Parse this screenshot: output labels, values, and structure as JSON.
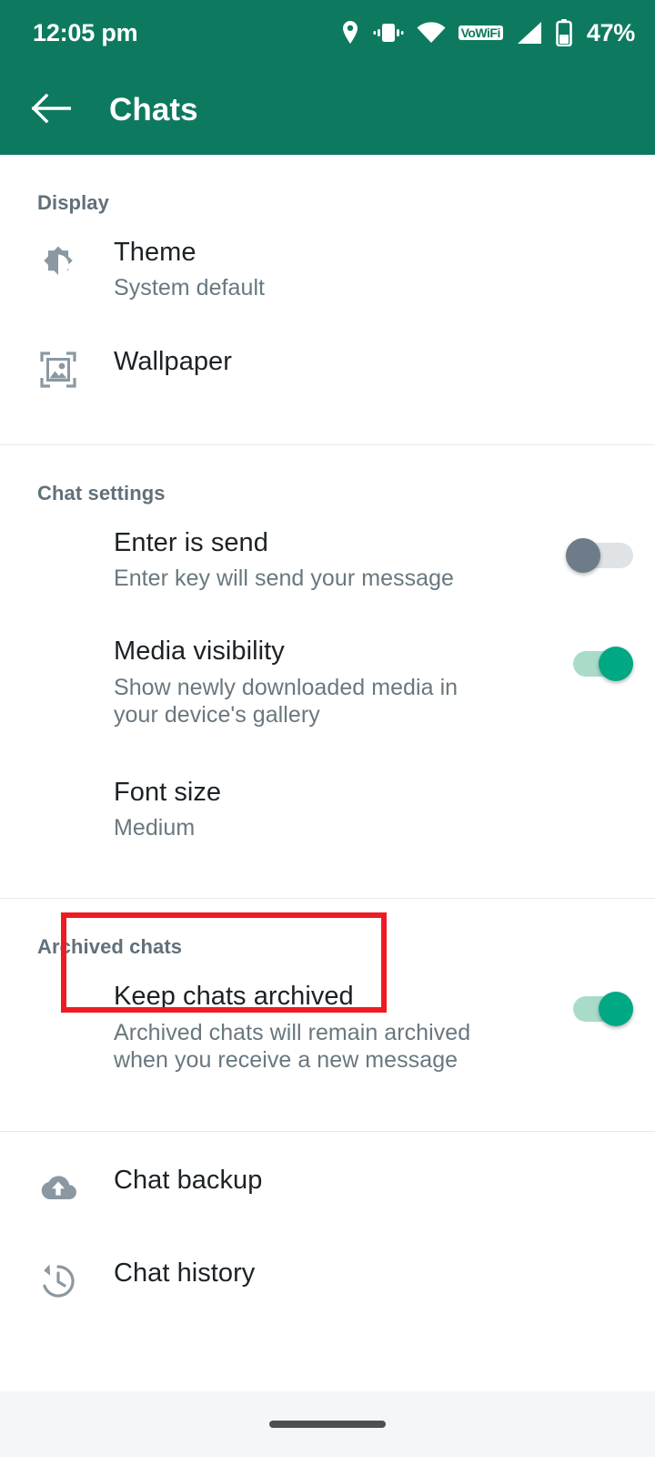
{
  "status_bar": {
    "time": "12:05 pm",
    "battery_percent": "47%",
    "vowifi_label": "VoWiFi",
    "icons": [
      "location-pin-icon",
      "vibrate-icon",
      "wifi-icon",
      "vowifi-badge",
      "signal-icon",
      "battery-icon"
    ]
  },
  "app_bar": {
    "back_icon": "back-arrow-icon",
    "title": "Chats"
  },
  "colors": {
    "header_green": "#0d7a5f",
    "toggle_on": "#00a884",
    "toggle_on_track": "#a8dcc9",
    "toggle_off": "#6d7c88",
    "toggle_off_track": "#dfe3e6",
    "highlight_red": "#ed1c24",
    "primary_text": "#1c2225",
    "secondary_text": "#69777f",
    "section_header_text": "#61707a"
  },
  "sections": [
    {
      "header": "Display",
      "rows": [
        {
          "icon": "brightness-theme-icon",
          "title": "Theme",
          "subtitle": "System default"
        },
        {
          "icon": "wallpaper-icon",
          "title": "Wallpaper",
          "subtitle": ""
        }
      ]
    },
    {
      "header": "Chat settings",
      "rows": [
        {
          "icon": "",
          "title": "Enter is send",
          "subtitle": "Enter key will send your message",
          "toggle": "off"
        },
        {
          "icon": "",
          "title": "Media visibility",
          "subtitle": "Show newly downloaded media in your device's gallery",
          "toggle": "on"
        },
        {
          "icon": "",
          "title": "Font size",
          "subtitle": "Medium",
          "highlighted": true
        }
      ]
    },
    {
      "header": "Archived chats",
      "rows": [
        {
          "icon": "",
          "title": "Keep chats archived",
          "subtitle": "Archived chats will remain archived when you receive a new message",
          "toggle": "on"
        }
      ]
    },
    {
      "header": "",
      "rows": [
        {
          "icon": "cloud-upload-icon",
          "title": "Chat backup",
          "subtitle": ""
        },
        {
          "icon": "history-clock-icon",
          "title": "Chat history",
          "subtitle": ""
        }
      ]
    }
  ],
  "nav_bar": {
    "gesture_pill": "home-gesture-pill"
  }
}
